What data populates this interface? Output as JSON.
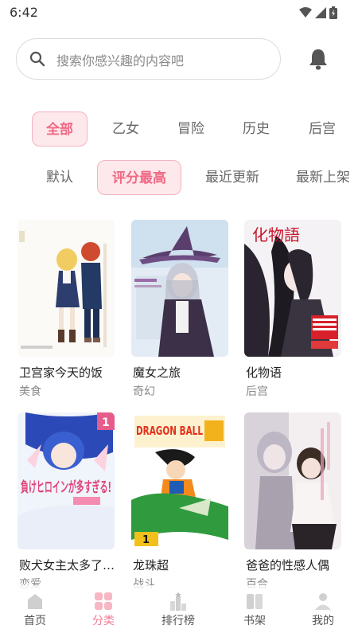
{
  "status": {
    "time": "6:42"
  },
  "search": {
    "placeholder": "搜索你感兴趣的内容吧"
  },
  "categories": [
    "全部",
    "乙女",
    "冒险",
    "历史",
    "后宫"
  ],
  "sort_options": [
    "默认",
    "评分最高",
    "最近更新",
    "最新上架"
  ],
  "comics": [
    {
      "title": "卫宫家今天的饭",
      "genre": "美食"
    },
    {
      "title": "魔女之旅",
      "genre": "奇幻"
    },
    {
      "title": "化物语",
      "genre": "后宫"
    },
    {
      "title": "败犬女主太多了…",
      "genre": "恋爱"
    },
    {
      "title": "龙珠超",
      "genre": "战斗"
    },
    {
      "title": "爸爸的性感人偶",
      "genre": "百合"
    }
  ],
  "cover_texts": {
    "dragonball": "DRAGON BALL",
    "bakemonogatari": "化物語",
    "makeine": "負けヒロインが多すぎる!",
    "volume_one": "1"
  },
  "nav": [
    "首页",
    "分类",
    "排行榜",
    "书架",
    "我的"
  ],
  "colors": {
    "accent": "#f06a85",
    "accent_bg": "#fde8ec",
    "accent_border": "#f4b3c0"
  }
}
